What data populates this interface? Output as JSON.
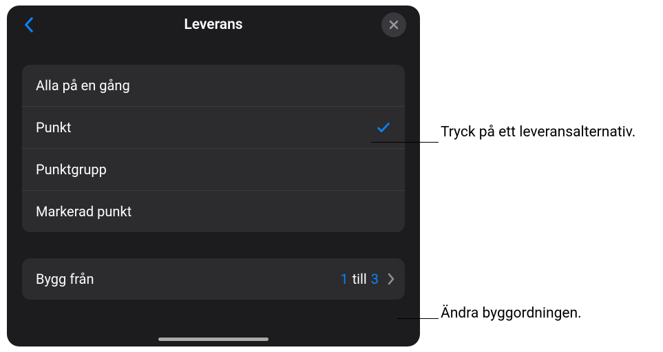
{
  "nav": {
    "title": "Leverans"
  },
  "options": [
    {
      "label": "Alla på en gång",
      "selected": false
    },
    {
      "label": "Punkt",
      "selected": true
    },
    {
      "label": "Punktgrupp",
      "selected": false
    },
    {
      "label": "Markerad punkt",
      "selected": false
    }
  ],
  "build": {
    "label": "Bygg från",
    "from": "1",
    "sep": "till",
    "to": "3"
  },
  "callouts": {
    "opt": "Tryck på ett leveransalternativ.",
    "order": "Ändra byggordningen."
  },
  "colors": {
    "accent": "#0a84ff"
  }
}
